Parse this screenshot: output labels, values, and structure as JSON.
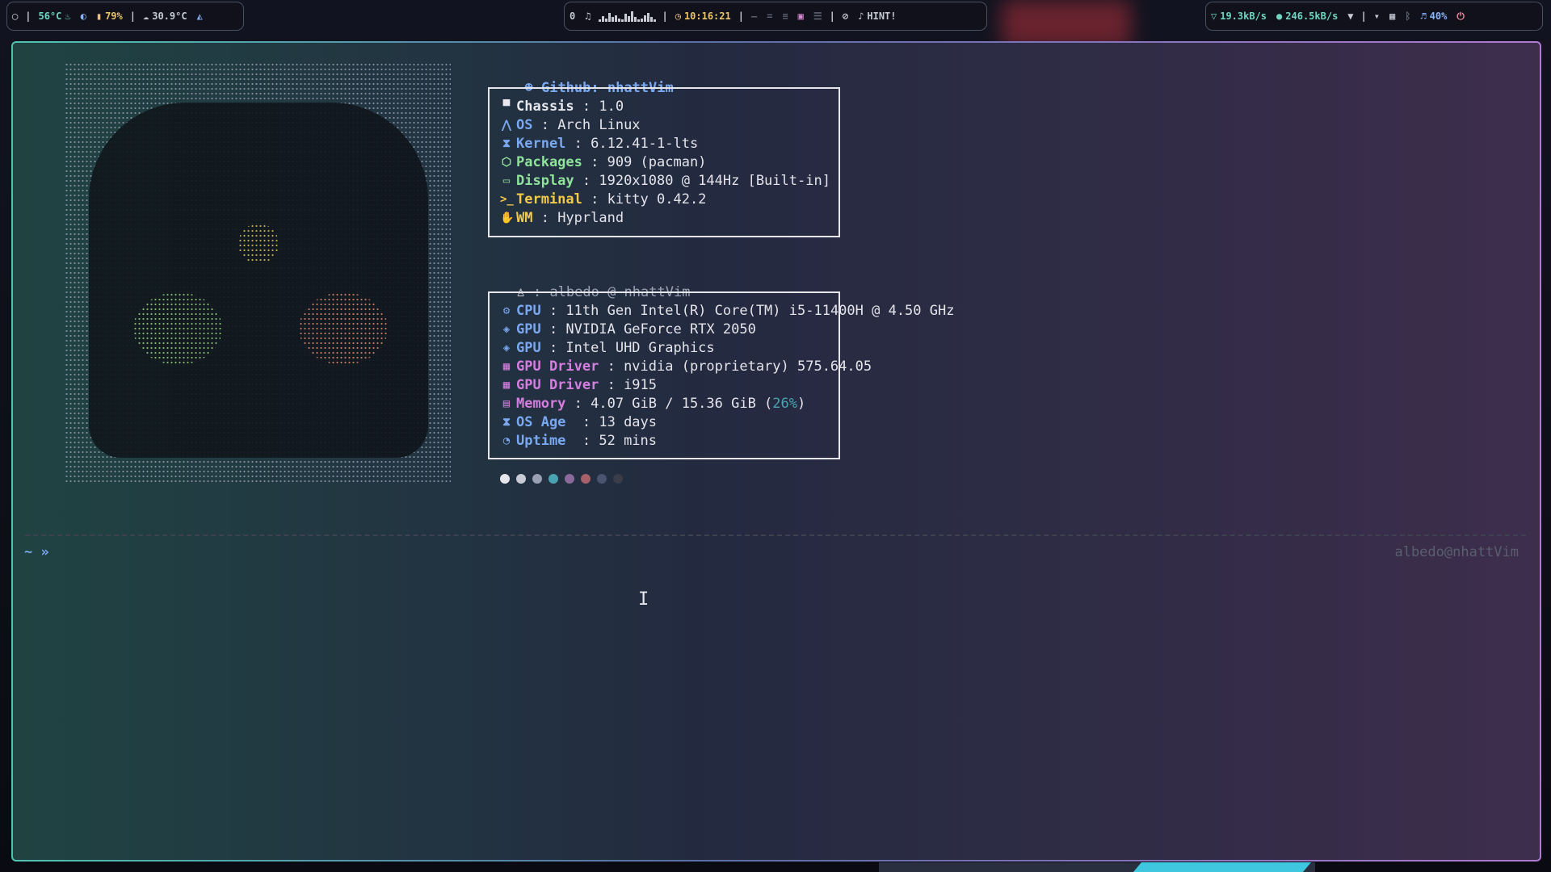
{
  "bar_left": {
    "cpu_temp": "56°C",
    "battery": "79%",
    "weather": "30.9°C"
  },
  "bar_center": {
    "notif_count": "0",
    "clock": "10:16:21",
    "hint": "HINT!",
    "cava_levels": [
      2,
      5,
      3,
      8,
      4,
      6,
      3,
      2,
      7,
      5,
      9,
      4,
      2,
      3,
      6,
      8,
      4,
      2
    ]
  },
  "bar_right": {
    "net_up": "19.3kB/s",
    "net_down": "246.5kB/s",
    "volume": "40%"
  },
  "fetch": {
    "github": "Github: nhattVim",
    "rows1": [
      {
        "icon": "chassis-icon",
        "glyph": "▀",
        "key": "Chassis",
        "val": " : 1.0"
      },
      {
        "icon": "arch-icon",
        "glyph": "⋀",
        "key": "OS",
        "val": " : Arch Linux"
      },
      {
        "icon": "hourglass-icon",
        "glyph": "⧗",
        "key": "Kernel",
        "val": " : 6.12.41-1-lts"
      },
      {
        "icon": "package-icon",
        "glyph": "⬡",
        "key": "Packages",
        "val": " : 909 (pacman)"
      },
      {
        "icon": "monitor-icon",
        "glyph": "▭",
        "key": "Display",
        "val": " : 1920x1080 @ 144Hz [Built-in]"
      },
      {
        "icon": "terminal-icon",
        "glyph": ">_",
        "key": "Terminal",
        "val": " : kitty 0.42.2"
      },
      {
        "icon": "hand-icon",
        "glyph": "✋",
        "key": "WM",
        "val": " : Hyprland"
      }
    ],
    "user_label": ": albedo @ nhattVim",
    "rows2": [
      {
        "icon": "cpu-icon",
        "glyph": "⚙",
        "key": "CPU",
        "val": " : 11th Gen Intel(R) Core(TM) i5-11400H @ 4.50 GHz"
      },
      {
        "icon": "gamepad-icon",
        "glyph": "◈",
        "key": "GPU",
        "val": " : NVIDIA GeForce RTX 2050"
      },
      {
        "icon": "gamepad-icon",
        "glyph": "◈",
        "key": "GPU",
        "val": " : Intel UHD Graphics"
      },
      {
        "icon": "driver-icon",
        "glyph": "▦",
        "key": "GPU Driver",
        "val": " : nvidia (proprietary) 575.64.05"
      },
      {
        "icon": "driver-icon",
        "glyph": "▦",
        "key": "GPU Driver",
        "val": " : i915"
      },
      {
        "icon": "memory-icon",
        "glyph": "▤",
        "key": "Memory",
        "val": " : 4.07 GiB / 15.36 GiB (",
        "extra": "26%",
        "tail": ")"
      },
      {
        "icon": "hourglass-icon",
        "glyph": "⧗",
        "key": "OS Age ",
        "val": " : 13 days"
      },
      {
        "icon": "clock-icon",
        "glyph": "◔",
        "key": "Uptime ",
        "val": " : 52 mins"
      }
    ],
    "palette": [
      "#e6e6ea",
      "#c8cad6",
      "#9aa0b4",
      "#4aa3b0",
      "#8a6a9a",
      "#a5606a",
      "#4a5470",
      "#3a3d4a"
    ]
  },
  "shell": {
    "prompt": "~ »",
    "right_prompt": "albedo@nhattVim"
  },
  "colors": {
    "accent_teal": "#4fc3b0",
    "accent_purple": "#b07ad0",
    "key_blue": "#7aa8f0",
    "key_green": "#8fe39a",
    "key_yellow": "#f2c94c"
  }
}
